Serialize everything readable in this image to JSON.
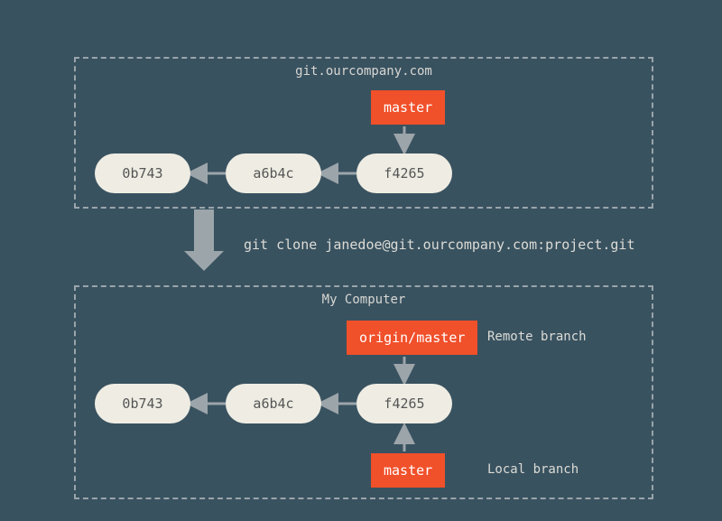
{
  "remote": {
    "title": "git.ourcompany.com",
    "commits": [
      "0b743",
      "a6b4c",
      "f4265"
    ],
    "ref": "master"
  },
  "clone_command": "git clone janedoe@git.ourcompany.com:project.git",
  "local": {
    "title": "My Computer",
    "commits": [
      "0b743",
      "a6b4c",
      "f4265"
    ],
    "refs": {
      "remote_tracking": "origin/master",
      "local": "master"
    },
    "labels": {
      "remote_branch": "Remote branch",
      "local_branch": "Local branch"
    }
  },
  "colors": {
    "bg": "#395260",
    "dash": "#9aa5ab",
    "commit": "#efede3",
    "ref": "#f0502a",
    "text_light": "#d7d7d2",
    "arrow": "#9ca5aa"
  }
}
